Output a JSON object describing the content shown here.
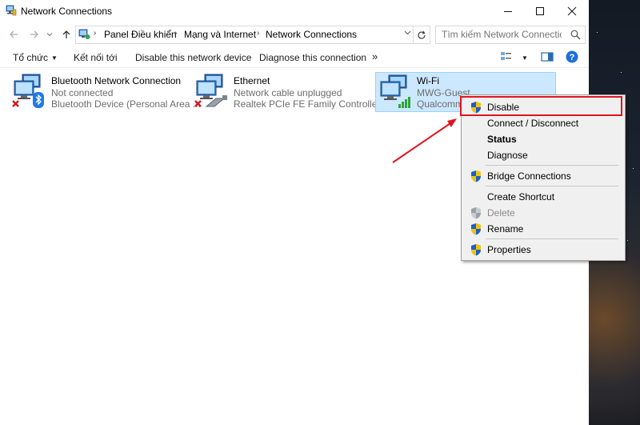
{
  "window": {
    "title": "Network Connections"
  },
  "address_bar": {
    "crumbs": [
      "Panel Điều khiển",
      "Mạng và Internet",
      "Network Connections"
    ]
  },
  "search": {
    "placeholder": "Tìm kiếm Network Connections"
  },
  "toolbar": {
    "organize": "Tổ chức",
    "connect_to": "Kết nối tới",
    "disable_device": "Disable this network device",
    "diagnose_connection": "Diagnose this connection",
    "more": "»"
  },
  "connections": [
    {
      "name": "Bluetooth Network Connection",
      "status": "Not connected",
      "device": "Bluetooth Device (Personal Area ...",
      "icon": "bluetooth-network-icon"
    },
    {
      "name": "Ethernet",
      "status": "Network cable unplugged",
      "device": "Realtek PCIe FE Family Controller",
      "icon": "ethernet-network-icon"
    },
    {
      "name": "Wi-Fi",
      "status": "MWG-Guest",
      "device": "Qualcomm",
      "icon": "wifi-network-icon"
    }
  ],
  "context_menu": {
    "items": [
      {
        "label": "Disable",
        "shield": true
      },
      {
        "label": "Connect / Disconnect",
        "shield": false
      },
      {
        "label": "Status",
        "shield": false,
        "bold": true
      },
      {
        "label": "Diagnose",
        "shield": false
      },
      {
        "label": "Bridge Connections",
        "shield": true
      },
      {
        "label": "Create Shortcut",
        "shield": false
      },
      {
        "label": "Delete",
        "shield": true,
        "disabled": true
      },
      {
        "label": "Rename",
        "shield": true
      },
      {
        "label": "Properties",
        "shield": true
      }
    ]
  },
  "colors": {
    "selection_bg": "#cce8ff",
    "selection_border": "#99d1ff",
    "highlight_red": "#e0141e",
    "help_blue": "#1e6fd9"
  }
}
